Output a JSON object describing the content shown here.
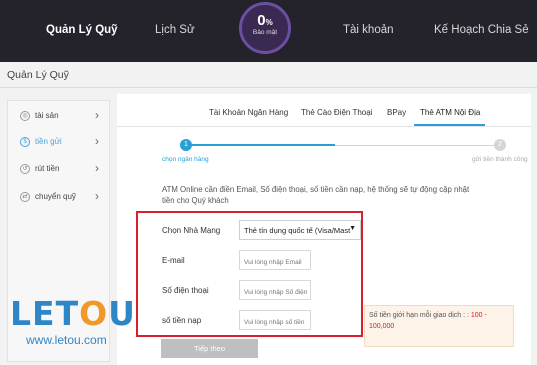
{
  "topnav": {
    "items": [
      "Quản Lý Quỹ",
      "Lịch Sử",
      "Tài khoản",
      "Kế Hoạch Chia Sẻ"
    ],
    "security_percent": "0",
    "security_percent_unit": "%",
    "security_label": "Bảo mật"
  },
  "page_title": "Quản Lý Quỹ",
  "sidebar": {
    "items": [
      {
        "icon": "assets-icon",
        "label": "tài sản"
      },
      {
        "icon": "deposit-icon",
        "label": "tiền gửi"
      },
      {
        "icon": "withdraw-icon",
        "label": "rút tiền"
      },
      {
        "icon": "transfer-icon",
        "label": "chuyển quỹ"
      }
    ],
    "chevron": "›"
  },
  "tabs": [
    "Tài Khoản Ngân Hàng",
    "Thẻ Cào Điện Thoại",
    "BPay",
    "Thẻ ATM Nội Địa"
  ],
  "steps": {
    "step1_number": "1",
    "step1_label": "chọn ngân hàng",
    "step2_number": "2",
    "step2_label": "gửi tiền thành công"
  },
  "notice": "ATM Online cần điền Email, Số điện thoại, số tiền cần nạp, hệ thống sẽ tự động cập nhật tiền cho Quý khách",
  "form": {
    "bank_label": "Chọn Nhà Mạng",
    "bank_value": "Thẻ tín dụng quốc tế (Visa/Mast",
    "email_label": "E-mail",
    "email_placeholder": "Vui lòng nhập Email",
    "phone_label": "Số điện thoại",
    "phone_placeholder": "Vui lòng nhập Số điện",
    "amount_label": "số tiền nạp",
    "amount_placeholder": "Vui lòng nhập số tiền",
    "limit_text": "Số tiền giới hạn mỗi giao dịch : :",
    "limit_range": "100 - 100,000",
    "next_button": "Tiếp theo"
  },
  "watermark": {
    "brand": "LETOU",
    "url": "www.letou.com"
  },
  "colors": {
    "nav_bg": "#24222b",
    "accent": "#2a9fd6",
    "highlight_border": "#d8202a",
    "brand_blue": "#2f86c6",
    "brand_orange": "#f0992a"
  }
}
